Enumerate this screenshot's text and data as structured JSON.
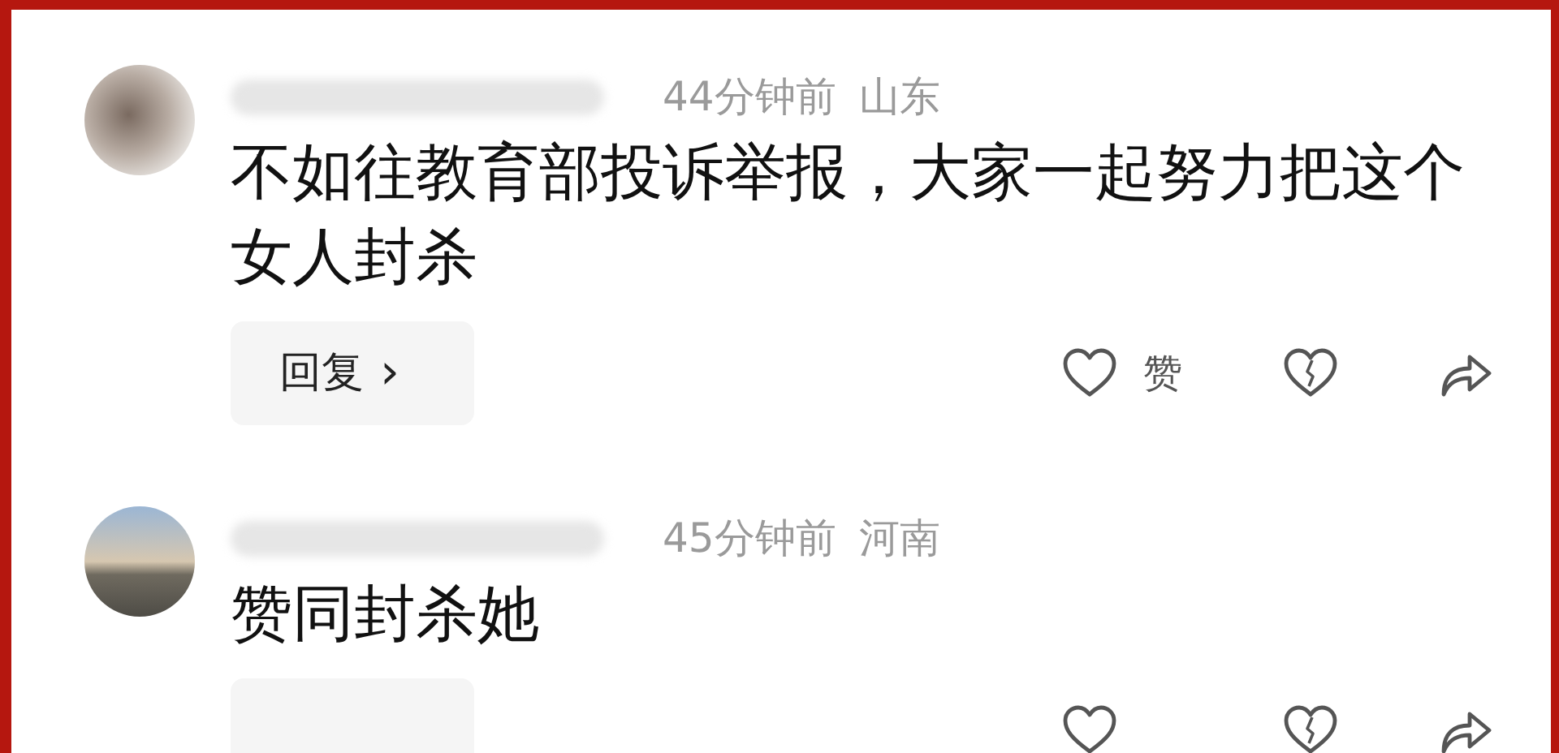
{
  "comments": [
    {
      "avatar": {
        "kind": "blurred"
      },
      "time": "44分钟前",
      "location": "山东",
      "text": "不如往教育部投诉举报，大家一起努力把这个女人封杀",
      "reply_label": "回复",
      "reply_arrow": "›",
      "like_label": "赞"
    },
    {
      "avatar": {
        "kind": "landscape"
      },
      "time": "45分钟前",
      "location": "河南",
      "text": "赞同封杀她"
    }
  ]
}
